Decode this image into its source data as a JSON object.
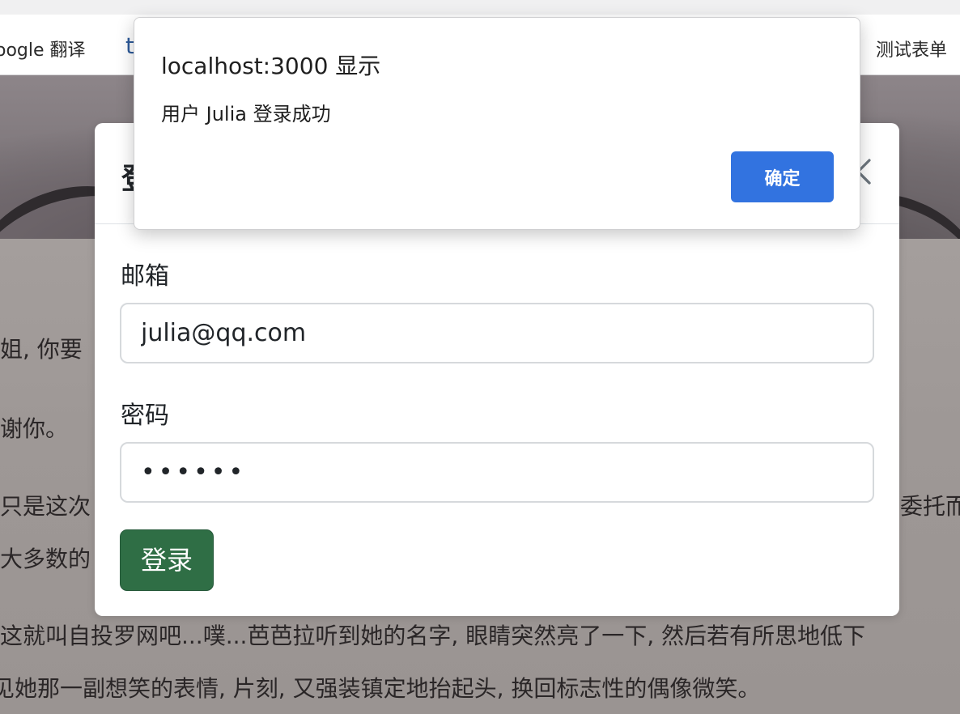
{
  "bookmarks": {
    "left_item": "oogle 翻译",
    "truncated_item": "t",
    "right_item": "测试表单"
  },
  "background_article": {
    "lines": [
      "姐, 你要",
      "谢你。",
      "只是这次",
      "委托而",
      "大多数的",
      "这就叫自投罗网吧...噗...芭芭拉听到她的名字, 眼睛突然亮了一下, 然后若有所思地低下",
      "见她那一副想笑的表情, 片刻, 又强装镇定地抬起头, 换回标志性的偶像微笑。"
    ]
  },
  "modal": {
    "title": "登",
    "email_label": "邮箱",
    "email_value": "julia@qq.com",
    "password_label": "密码",
    "password_value": "••••••",
    "login_label": "登录",
    "close_icon": "close-icon"
  },
  "alert": {
    "title": "localhost:3000 显示",
    "message": "用户 Julia 登录成功",
    "ok_label": "确定"
  },
  "colors": {
    "login_button": "#2f6e45",
    "alert_button": "#3273e0"
  }
}
